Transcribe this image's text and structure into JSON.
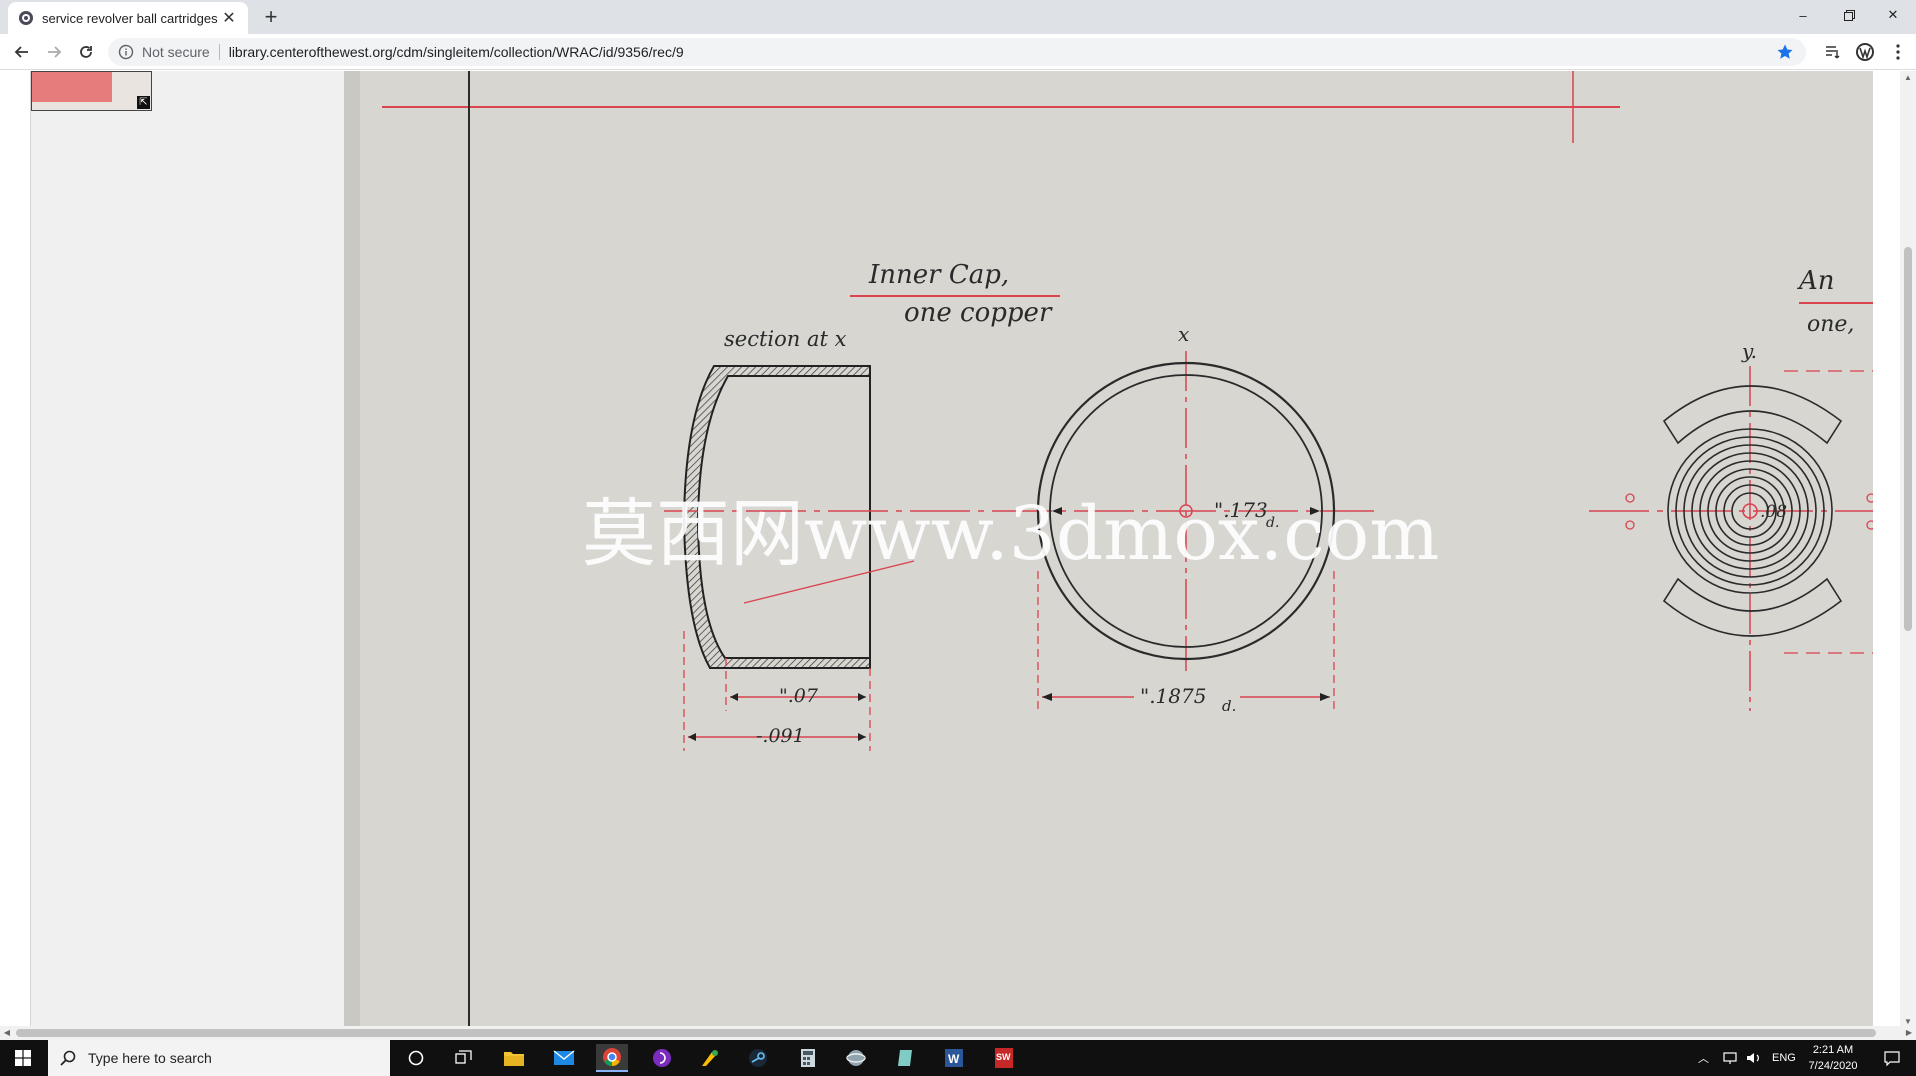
{
  "browser": {
    "tab_title": "service revolver ball cartridges - ",
    "security_label": "Not secure",
    "url": "library.centerofthewest.org/cdm/singleitem/collection/WRAC/id/9356/rec/9"
  },
  "drawing": {
    "heading": "Inner Cap,",
    "subheading": "one copper",
    "section_label": "section at x",
    "x_mark": "x",
    "y_mark": "y.",
    "dim_inner_depth": "\".07",
    "dim_total_depth": "-.091",
    "dim_outer_diameter": "\".1875",
    "dim_outer_diameter_suffix": "d.",
    "dim_inner_diameter": "\".173",
    "dim_inner_diameter_suffix": "d.",
    "dim_right_part": ".08",
    "right_heading_partial": "An",
    "right_subheading_partial": "one,"
  },
  "watermark": "莫西网www.3dmox.com",
  "taskbar": {
    "search_placeholder": "Type here to search",
    "language": "ENG",
    "time": "2:21 AM",
    "date": "7/24/2020"
  },
  "colors": {
    "paper": "#d7d6d1",
    "red_line": "#d9444f",
    "ink": "#2a2a2a"
  }
}
